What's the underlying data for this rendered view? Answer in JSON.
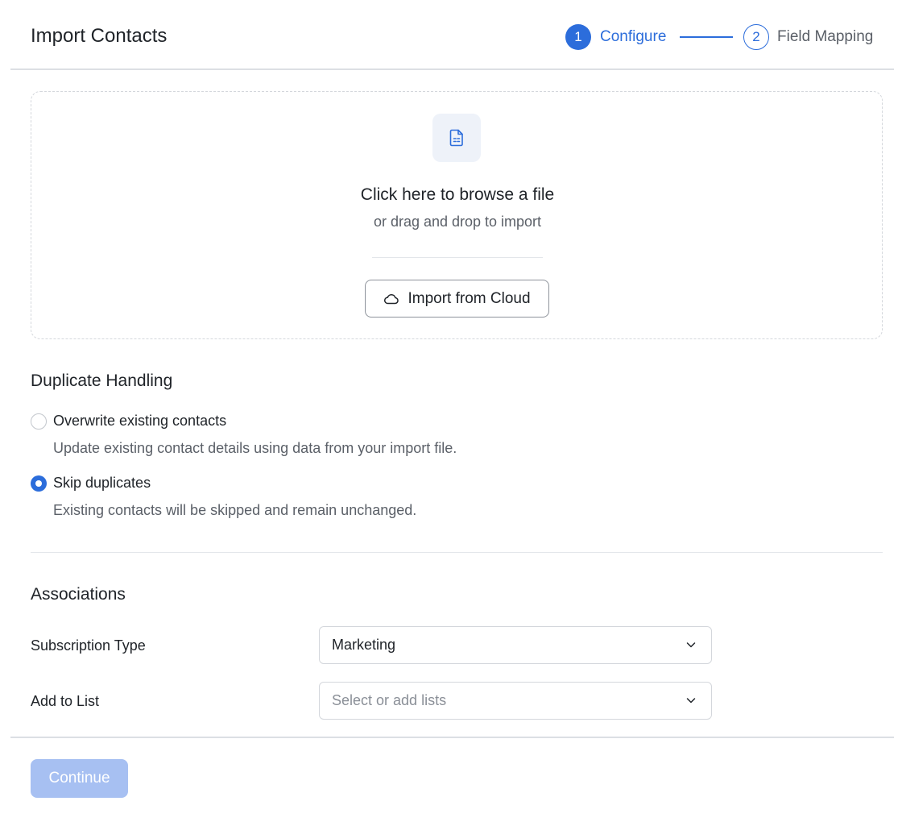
{
  "header": {
    "title": "Import Contacts",
    "steps": [
      {
        "number": "1",
        "label": "Configure",
        "state": "active"
      },
      {
        "number": "2",
        "label": "Field Mapping",
        "state": "upcoming"
      }
    ]
  },
  "dropzone": {
    "icon": "file-spreadsheet-icon",
    "title": "Click here to browse a file",
    "subtitle": "or drag and drop to import",
    "cloud_button": {
      "icon": "cloud-icon",
      "label": "Import from Cloud"
    }
  },
  "duplicate_handling": {
    "title": "Duplicate Handling",
    "options": [
      {
        "label": "Overwrite existing contacts",
        "description": "Update existing contact details using data from your import file.",
        "selected": false
      },
      {
        "label": "Skip duplicates",
        "description": "Existing contacts will be skipped and remain unchanged.",
        "selected": true
      }
    ]
  },
  "associations": {
    "title": "Associations",
    "subscription_type": {
      "label": "Subscription Type",
      "value": "Marketing",
      "icon": "chevron-down-icon"
    },
    "add_to_list": {
      "label": "Add to List",
      "placeholder": "Select or add lists",
      "icon": "chevron-down-icon"
    }
  },
  "footer": {
    "continue_label": "Continue",
    "continue_enabled": false
  },
  "colors": {
    "accent": "#2c6ddb",
    "disabled_button": "#a7c0f2"
  }
}
